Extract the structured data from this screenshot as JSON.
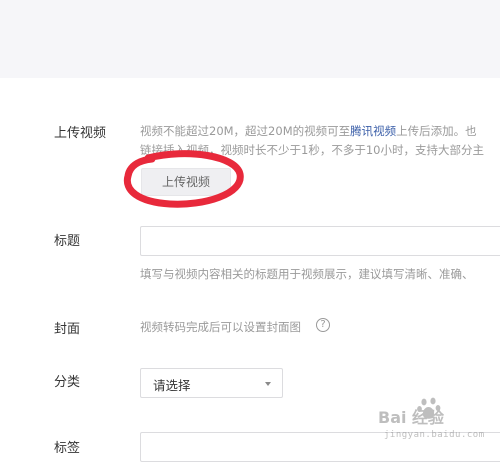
{
  "form": {
    "upload": {
      "label": "上传视频",
      "hint_line1_a": "视频不能超过20M，超过20M的视频可至",
      "hint_line1_link": "腾讯视频",
      "hint_line1_b": "上传后添加。也",
      "hint_line2": "链接插入视频，视频时长不少于1秒，不多于10小时，支持大部分主",
      "button_label": "上传视频"
    },
    "title": {
      "label": "标题",
      "value": "",
      "hint": "填写与视频内容相关的标题用于视频展示，建议填写清晰、准确、"
    },
    "cover": {
      "label": "封面",
      "hint": "视频转码完成后可以设置封面图",
      "help_glyph": "?"
    },
    "category": {
      "label": "分类",
      "selected": "请选择"
    },
    "tags": {
      "label": "标签",
      "value": ""
    }
  },
  "watermark": {
    "brand_text": "Bai 经验",
    "sub_text": "jingyan.baidu.com"
  },
  "annotation": {
    "circle_color": "#e8293b"
  }
}
